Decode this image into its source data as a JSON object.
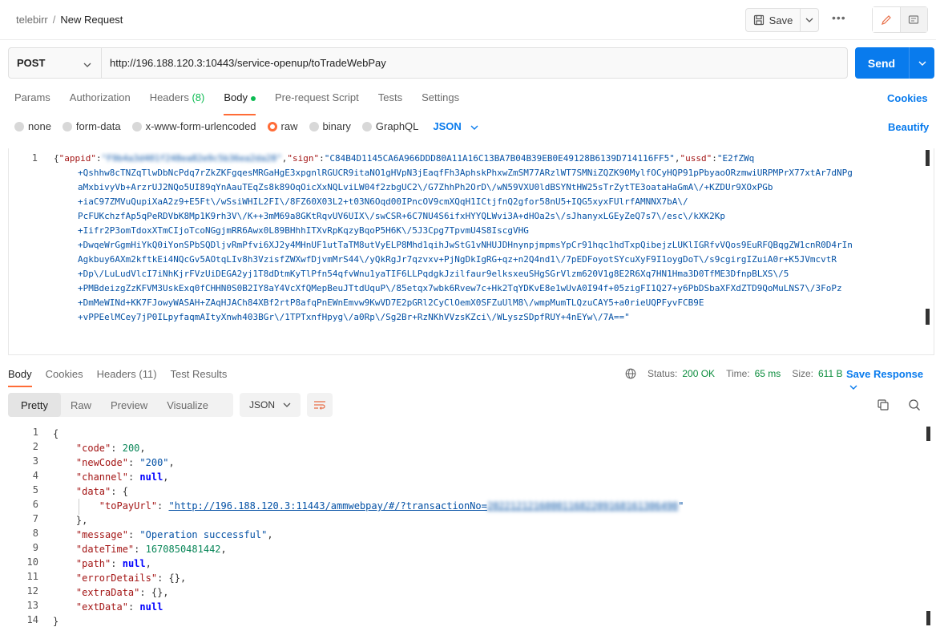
{
  "header": {
    "workspace": "telebirr",
    "separator": "/",
    "request_name": "New Request",
    "save_label": "Save",
    "more_label": "•••"
  },
  "url_bar": {
    "method": "POST",
    "url": "http://196.188.120.3:10443/service-openup/toTradeWebPay",
    "send_label": "Send"
  },
  "request_tabs": {
    "params": "Params",
    "authorization": "Authorization",
    "headers": "Headers",
    "headers_count": "(8)",
    "body": "Body",
    "pre_request": "Pre-request Script",
    "tests": "Tests",
    "settings": "Settings",
    "cookies": "Cookies"
  },
  "body_types": {
    "none": "none",
    "form_data": "form-data",
    "urlencoded": "x-www-form-urlencoded",
    "raw": "raw",
    "binary": "binary",
    "graphql": "GraphQL",
    "format": "JSON",
    "beautify": "Beautify"
  },
  "request_body": {
    "line_number": "1",
    "key_appid": "\"appid\"",
    "appid_value": "\"F9b4a3d401f248ea82e9c5b36ea2da28\"",
    "key_sign": "\"sign\"",
    "sign_value": "\"C84B4D1145CA6A966DDD80A11A16C13BA7B04B39EB0E49128B6139D714116FF5\"",
    "key_ussd": "\"ussd\"",
    "ussd_first": "\"E2fZWq",
    "ussd_lines": [
      "+Qshhw8cTNZqTlwDbNcPdq7rZkZKFgqesMRGaHgE3xpgnlRGUCR9itaNO1gHVpN3jEaqfFh3AphskPhxwZmSM77ARzlWT7SMNiZQZK90MylfOCyHQP91pPbyaoORzmwiURPMPrX77xtAr7dNPg",
      "aMxbivyVb+ArzrUJ2NQo5UI89qYnAauTEqZs8k89OqOicXxNQLviLW04f2zbgUC2\\/G7ZhhPh2OrD\\/wN59VXU0ldBSYNtHW25sTrZytTE3oataHaGmA\\/+KZDUr9XOxPGb",
      "+iaC97ZMVuQupiXaA2z9+E5Ft\\/wSsiWHIL2FI\\/8FZ60X03L2+t03N6Oqd00IPncOV9cmXQqH1ICtjfnQ2gfor58nU5+IQG5xyxFUlrfAMNNX7bA\\/",
      "PcFUKchzfAp5qPeRDVbK8Mp1K9rh3V\\/K++3mM69a8GKtRqvUV6UIX\\/swCSR+6C7NU4S6ifxHYYQLWvi3A+dHOa2s\\/sJhanyxLGEyZeQ7s7\\/esc\\/kXK2Kp",
      "+Iifr2P3omTdoxXTmCIjoTcoNGgjmRR6Awx0L89BHhhITXvRpKqzyBqoP5H6K\\/5J3Cpg7TpvmU4S8IscgVHG",
      "+DwqeWrGgmHiYkQ0iYonSPbSQDljvRmPfvi6XJ2y4MHnUF1utTaTM8utVyELP8Mhd1qihJwStG1vNHUJDHnynpjmpmsYpCr91hqc1hdTxpQibejzLUKlIGRfvVQos9EuRFQBqgZW1cnR0D4rIn",
      "Agkbuy6AXm2kftkEi4NQcGv5AOtqLIv8h3VzisfZWXwfDjvmMrS44\\/yQkRgJr7qzvxv+PjNgDkIgRG+qz+n2Q4nd1\\/7pEDFoyotSYcuXyF9I1oygDoT\\/s9cgirgIZuiA0r+K5JVmcvtR",
      "+Dp\\/LuLudVlcI7iNhKjrFVzUiDEGA2yj1T8dDtmKyTlPfn54qfvWnu1yaTIF6LLPqdgkJzilfaur9elksxeuSHgSGrVlzm620V1g8E2R6Xq7HN1Hma3D0TfME3DfnpBLXS\\/5",
      "+PMBdeizgZzKFVM3UskExq0fCHHN0S0B2IY8aY4VcXfQMepBeuJTtdUquP\\/85etqx7wbk6Rvew7c+Hk2TqYDKvE8e1wUvA0I94f+05zigFI1Q27+y6PbDSbaXFXdZTD9QoMuLNS7\\/3FoPz",
      "+DmMeWINd+KK7FJowyWASAH+ZAqHJACh84XBf2rtP8afqPnEWnEmvw9KwVD7E2pGRl2CyClOemX0SFZuUlM8\\/wmpMumTLQzuCAY5+a0rieUQPFyvFCB9E",
      "+vPPEelMCey7jP0ILpyfaqmAItyXnwh403BGr\\/1TPTxnfHpyg\\/a0Rp\\/Sg2Br+RzNKhVVzsKZci\\/WLyszSDpfRUY+4nEYw\\/7A==\""
    ]
  },
  "response_tabs": {
    "body": "Body",
    "cookies": "Cookies",
    "headers": "Headers",
    "headers_count": "(11)",
    "test_results": "Test Results"
  },
  "response_status": {
    "status_label": "Status:",
    "status_value": "200 OK",
    "time_label": "Time:",
    "time_value": "65 ms",
    "size_label": "Size:",
    "size_value": "611 B",
    "save_response": "Save Response"
  },
  "response_view": {
    "pretty": "Pretty",
    "raw": "Raw",
    "preview": "Preview",
    "visualize": "Visualize",
    "format": "JSON"
  },
  "response_body": {
    "line_numbers": [
      "1",
      "2",
      "3",
      "4",
      "5",
      "6",
      "7",
      "8",
      "9",
      "10",
      "11",
      "12",
      "13",
      "14"
    ],
    "open_brace": "{",
    "close_brace": "}",
    "k_code": "\"code\"",
    "v_code": "200",
    "k_newcode": "\"newCode\"",
    "v_newcode": "\"200\"",
    "k_channel": "\"channel\"",
    "v_null": "null",
    "k_data": "\"data\"",
    "k_topayurl": "\"toPayUrl\"",
    "v_topayurl": "\"http://196.188.120.3:11443/ammwebpay/#/?transactionNo=",
    "v_txn": "202212121600011682209168161306490",
    "k_message": "\"message\"",
    "v_message": "\"Operation successful\"",
    "k_datetime": "\"dateTime\"",
    "v_datetime": "1670850481442",
    "k_path": "\"path\"",
    "k_errordetails": "\"errorDetails\"",
    "k_extradata": "\"extraData\"",
    "k_extdata": "\"extData\"",
    "v_empty_obj": "{}"
  }
}
